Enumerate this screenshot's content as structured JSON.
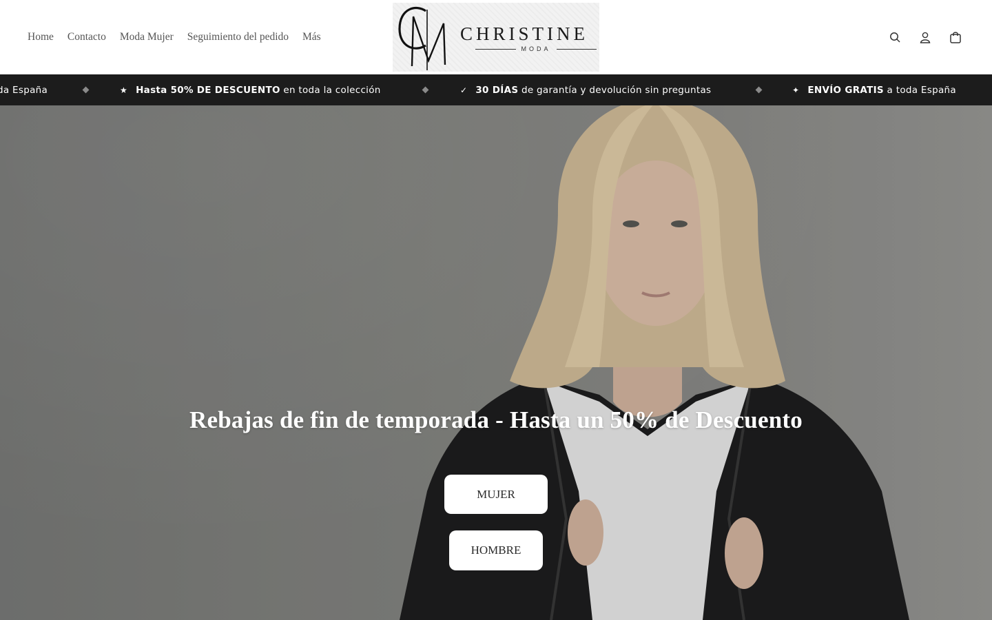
{
  "header": {
    "nav": [
      "Home",
      "Contacto",
      "Moda Mujer",
      "Seguimiento del pedido",
      "Más"
    ],
    "logo": {
      "monogram": "CM",
      "word": "CHRISTINE",
      "sub": "MODA"
    },
    "icons": [
      "search-icon",
      "account-icon",
      "cart-icon"
    ]
  },
  "announcement": {
    "items": [
      {
        "glyph": "",
        "bold": "",
        "text": "da España"
      },
      {
        "glyph": "★",
        "bold": "Hasta 50% DE DESCUENTO",
        "text": " en toda la colección"
      },
      {
        "glyph": "✓",
        "bold": "30 DÍAS",
        "text": " de garantía y devolución sin preguntas"
      },
      {
        "glyph": "✦",
        "bold": "ENVÍO GRATIS",
        "text": " a toda España"
      }
    ]
  },
  "hero": {
    "title": "Rebajas de fin de temporada - Hasta un 50% de Descuento",
    "buttons": {
      "mujer": "MUJER",
      "hombre": "HOMBRE"
    }
  },
  "colors": {
    "bar_bg": "#1c1c1c",
    "text_dark": "#2a2a2a",
    "hero_bg": "#878884",
    "white": "#ffffff"
  }
}
